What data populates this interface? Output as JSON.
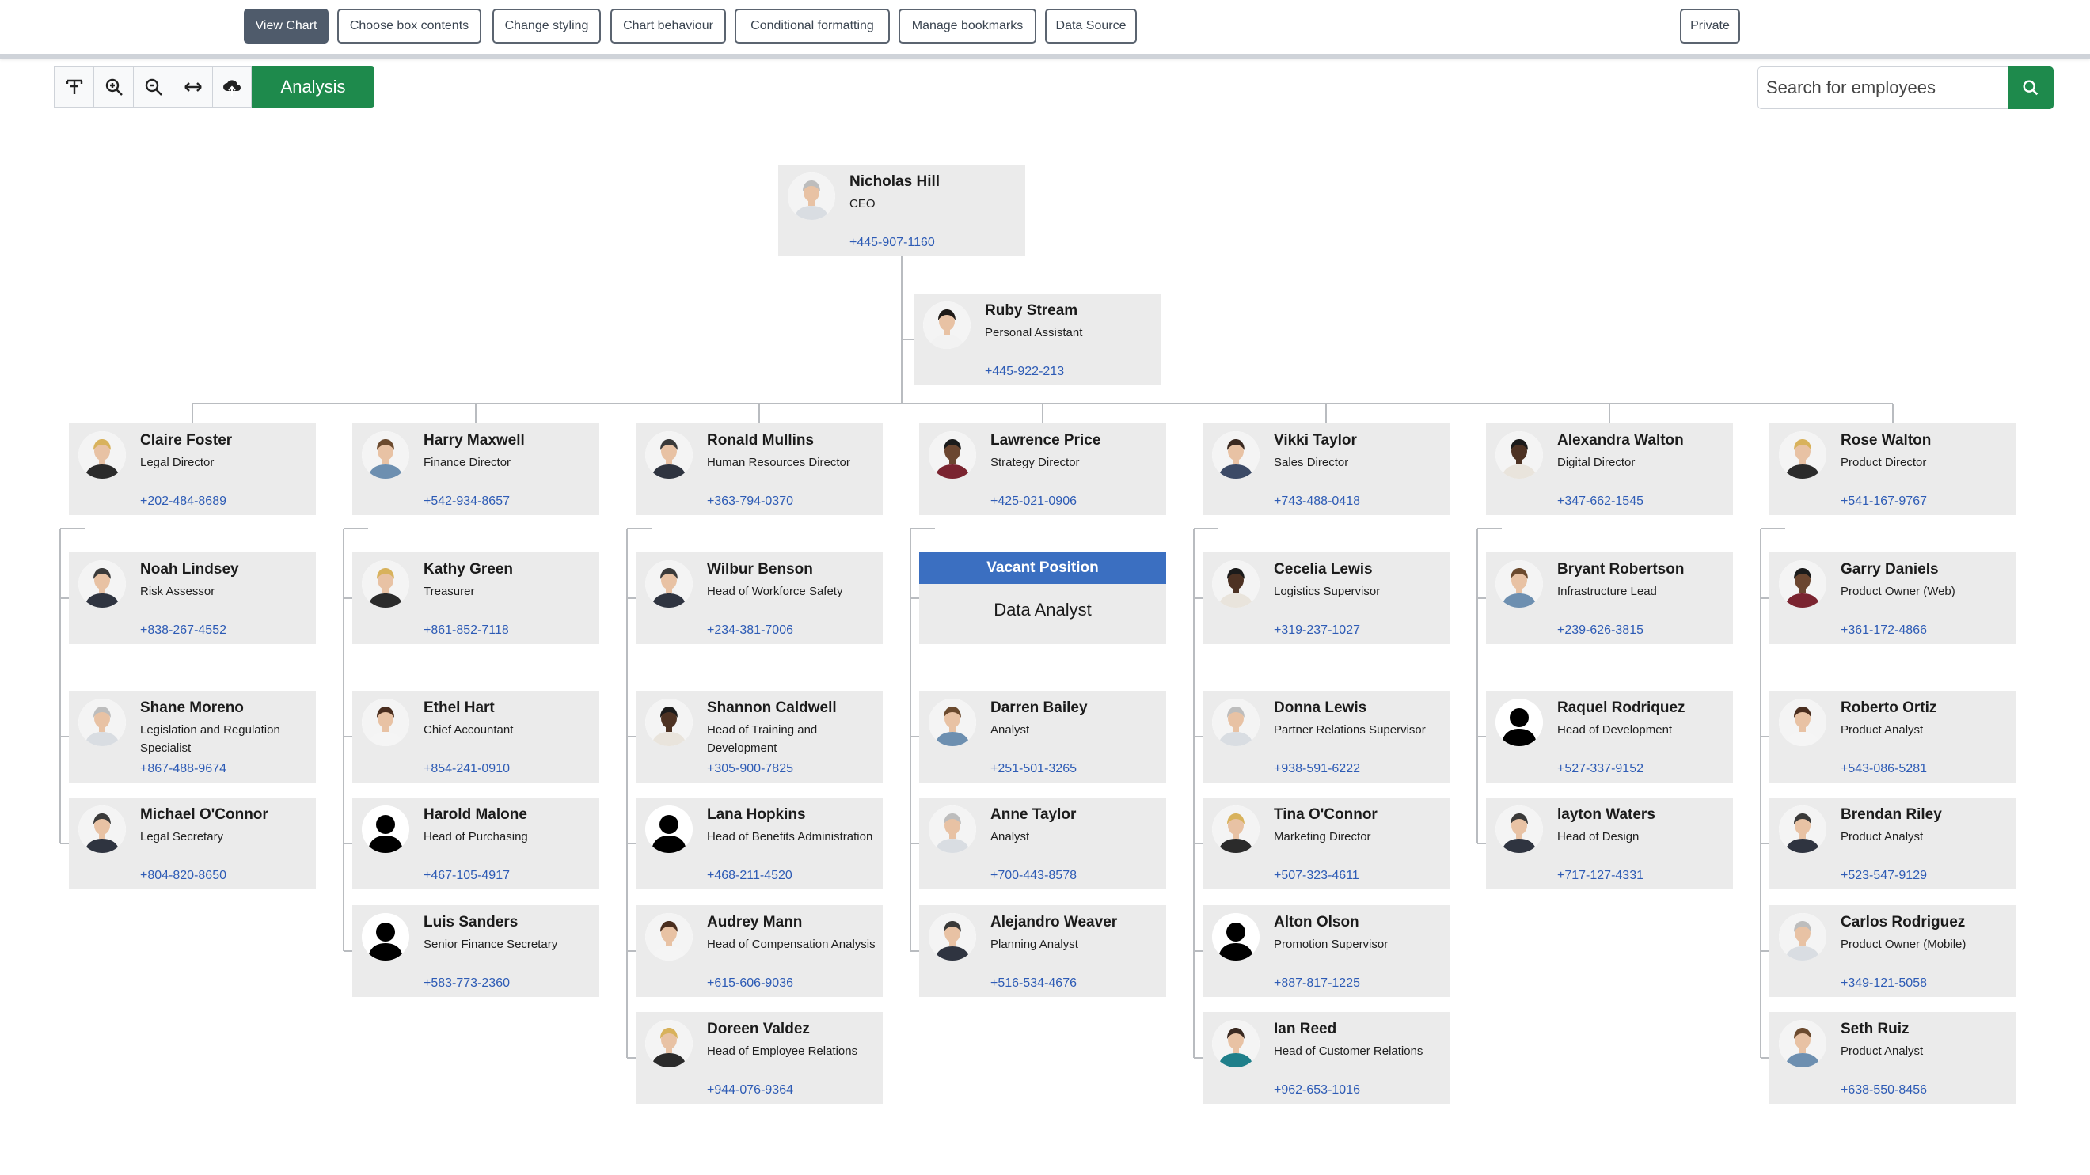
{
  "tabs": [
    {
      "label": "View Chart",
      "active": true
    },
    {
      "label": "Choose box contents",
      "active": false
    },
    {
      "label": "Change styling",
      "active": false
    },
    {
      "label": "Chart behaviour",
      "active": false
    },
    {
      "label": "Conditional formatting",
      "active": false
    },
    {
      "label": "Manage bookmarks",
      "active": false
    },
    {
      "label": "Data Source",
      "active": false
    },
    {
      "label": "Private",
      "active": false
    }
  ],
  "toolbar": {
    "tools": [
      "text-size-icon",
      "zoom-in-icon",
      "zoom-out-icon",
      "fit-width-icon",
      "cloud-upload-icon"
    ],
    "analysis_label": "Analysis"
  },
  "search": {
    "placeholder": "Search for employees"
  },
  "colors": {
    "accent_green": "#1e8a4c",
    "phone_blue": "#2d5bb5",
    "card_bg": "#ebebeb",
    "vacant_blue": "#3b6fc1",
    "active_tab": "#4f5b6b"
  },
  "people": [
    {
      "id": "ceo",
      "name": "Nicholas Hill",
      "title": "CEO",
      "phone": "+445-907-1160",
      "avatar": "grey"
    },
    {
      "id": "pa",
      "name": "Ruby Stream",
      "title": "Personal Assistant",
      "phone": "+445-922-213",
      "avatar": "asian-f"
    },
    {
      "id": "d1",
      "name": "Claire Foster",
      "title": "Legal Director",
      "phone": "+202-484-8689",
      "avatar": "blonde-f"
    },
    {
      "id": "d2",
      "name": "Harry Maxwell",
      "title": "Finance Director",
      "phone": "+542-934-8657",
      "avatar": "beard-m"
    },
    {
      "id": "d3",
      "name": "Ronald Mullins",
      "title": "Human Resources Director",
      "phone": "+363-794-0370",
      "avatar": "suit-m"
    },
    {
      "id": "d4",
      "name": "Lawrence Price",
      "title": "Strategy Director",
      "phone": "+425-021-0906",
      "avatar": "dark-m"
    },
    {
      "id": "d5",
      "name": "Vikki Taylor",
      "title": "Sales Director",
      "phone": "+743-488-0418",
      "avatar": "glasses-f"
    },
    {
      "id": "d6",
      "name": "Alexandra Walton",
      "title": "Digital Director",
      "phone": "+347-662-1545",
      "avatar": "dark-f"
    },
    {
      "id": "d7",
      "name": "Rose Walton",
      "title": "Product Director",
      "phone": "+541-167-9767",
      "avatar": "blonde-f"
    },
    {
      "id": "c11",
      "name": "Noah Lindsey",
      "title": "Risk Assessor",
      "phone": "+838-267-4552",
      "avatar": "suit-m"
    },
    {
      "id": "c12",
      "name": "Shane Moreno",
      "title": "Legislation and Regulation Specialist",
      "phone": "+867-488-9674",
      "avatar": "grey"
    },
    {
      "id": "c13",
      "name": "Michael O'Connor",
      "title": "Legal Secretary",
      "phone": "+804-820-8650",
      "avatar": "suit-m"
    },
    {
      "id": "c21",
      "name": "Kathy Green",
      "title": "Treasurer",
      "phone": "+861-852-7118",
      "avatar": "blonde-f"
    },
    {
      "id": "c22",
      "name": "Ethel Hart",
      "title": "Chief Accountant",
      "phone": "+854-241-0910",
      "avatar": "brown-f"
    },
    {
      "id": "c23",
      "name": "Harold Malone",
      "title": "Head of Purchasing",
      "phone": "+467-105-4917",
      "avatar": "silhouette"
    },
    {
      "id": "c24",
      "name": "Luis Sanders",
      "title": "Senior Finance Secretary",
      "phone": "+583-773-2360",
      "avatar": "silhouette"
    },
    {
      "id": "c31",
      "name": "Wilbur Benson",
      "title": "Head of Workforce Safety",
      "phone": "+234-381-7006",
      "avatar": "suit-m"
    },
    {
      "id": "c32",
      "name": "Shannon Caldwell",
      "title": "Head of Training and Development",
      "phone": "+305-900-7825",
      "avatar": "dark-f"
    },
    {
      "id": "c33",
      "name": "Lana Hopkins",
      "title": "Head of Benefits Administration",
      "phone": "+468-211-4520",
      "avatar": "silhouette"
    },
    {
      "id": "c34",
      "name": "Audrey Mann",
      "title": "Head of Compensation Analysis",
      "phone": "+615-606-9036",
      "avatar": "brown-f"
    },
    {
      "id": "c35",
      "name": "Doreen Valdez",
      "title": "Head of Employee Relations",
      "phone": "+944-076-9364",
      "avatar": "blonde-f"
    },
    {
      "id": "c42",
      "name": "Darren Bailey",
      "title": "Analyst",
      "phone": "+251-501-3265",
      "avatar": "beard-m"
    },
    {
      "id": "c43",
      "name": "Anne Taylor",
      "title": "Analyst",
      "phone": "+700-443-8578",
      "avatar": "grey"
    },
    {
      "id": "c44",
      "name": "Alejandro Weaver",
      "title": "Planning Analyst",
      "phone": "+516-534-4676",
      "avatar": "suit-m"
    },
    {
      "id": "c51",
      "name": "Cecelia Lewis",
      "title": "Logistics Supervisor",
      "phone": "+319-237-1027",
      "avatar": "dark-f"
    },
    {
      "id": "c52",
      "name": "Donna Lewis",
      "title": "Partner Relations Supervisor",
      "phone": "+938-591-6222",
      "avatar": "grey"
    },
    {
      "id": "c53",
      "name": "Tina O'Connor",
      "title": "Marketing Director",
      "phone": "+507-323-4611",
      "avatar": "blonde-f"
    },
    {
      "id": "c54",
      "name": "Alton Olson",
      "title": "Promotion Supervisor",
      "phone": "+887-817-1225",
      "avatar": "silhouette"
    },
    {
      "id": "c55",
      "name": "Ian Reed",
      "title": "Head of Customer Relations",
      "phone": "+962-653-1016",
      "avatar": "teal-m"
    },
    {
      "id": "c61",
      "name": "Bryant Robertson",
      "title": "Infrastructure Lead",
      "phone": "+239-626-3815",
      "avatar": "beard-m"
    },
    {
      "id": "c62",
      "name": "Raquel Rodriquez",
      "title": "Head of Development",
      "phone": "+527-337-9152",
      "avatar": "silhouette"
    },
    {
      "id": "c63",
      "name": "layton Waters",
      "title": "Head of Design",
      "phone": "+717-127-4331",
      "avatar": "suit-m"
    },
    {
      "id": "c71",
      "name": "Garry Daniels",
      "title": "Product Owner (Web)",
      "phone": "+361-172-4866",
      "avatar": "dark-m"
    },
    {
      "id": "c72",
      "name": "Roberto Ortiz",
      "title": "Product Analyst",
      "phone": "+543-086-5281",
      "avatar": "brown-f"
    },
    {
      "id": "c73",
      "name": "Brendan Riley",
      "title": "Product Analyst",
      "phone": "+523-547-9129",
      "avatar": "suit-m"
    },
    {
      "id": "c74",
      "name": "Carlos Rodriguez",
      "title": "Product Owner (Mobile)",
      "phone": "+349-121-5058",
      "avatar": "grey"
    },
    {
      "id": "c75",
      "name": "Seth Ruiz",
      "title": "Product Analyst",
      "phone": "+638-550-8456",
      "avatar": "beard-m"
    }
  ],
  "vacant": {
    "id": "c41",
    "label": "Vacant Position",
    "role": "Data Analyst"
  }
}
